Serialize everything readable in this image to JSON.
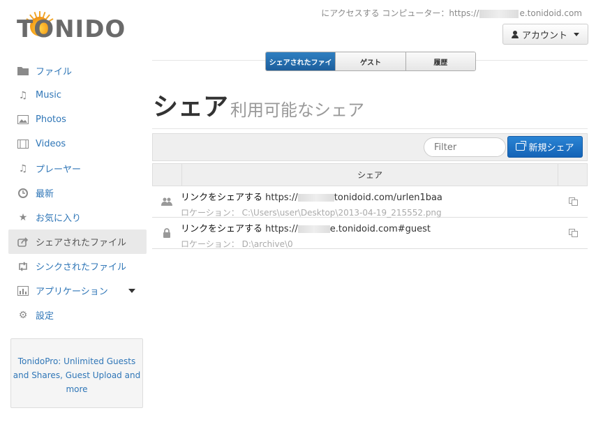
{
  "header": {
    "logo_text": "TONIDO",
    "access_prefix": "にアクセスする コンピューター：https://",
    "access_suffix": "e.tonidoid.com",
    "account_label": "アカウント"
  },
  "sidebar": {
    "items": [
      {
        "label": "ファイル",
        "icon": "folder-icon"
      },
      {
        "label": "Music",
        "icon": "music-icon"
      },
      {
        "label": "Photos",
        "icon": "photo-icon"
      },
      {
        "label": "Videos",
        "icon": "film-icon"
      },
      {
        "label": "プレーヤー",
        "icon": "music-icon"
      },
      {
        "label": "最新",
        "icon": "clock-icon"
      },
      {
        "label": "お気に入り",
        "icon": "star-icon"
      },
      {
        "label": "シェアされたファイル",
        "icon": "share-icon",
        "active": true
      },
      {
        "label": "シンクされたファイル",
        "icon": "sync-icon"
      },
      {
        "label": "アプリケーション",
        "icon": "chart-icon"
      },
      {
        "label": "設定",
        "icon": "gears-icon"
      }
    ],
    "promo": "TonidoPro: Unlimited Guests and Shares, Guest Upload and more"
  },
  "tabs": [
    {
      "label": "シェアされたファイ",
      "active": true
    },
    {
      "label": "ゲスト"
    },
    {
      "label": "履歴"
    }
  ],
  "page": {
    "title": "シェア",
    "subtitle": "利用可能なシェア"
  },
  "toolbar": {
    "filter_placeholder": "Filter",
    "new_share_label": "新規シェア"
  },
  "table": {
    "header": "シェア",
    "rows": [
      {
        "icon": "group-icon",
        "label": "リンクをシェアする",
        "url_prefix": "https://",
        "url_suffix": "tonidoid.com/urlen1baa",
        "location_label": "ロケーション：",
        "location": "C:\\Users\\user\\Desktop\\2013-04-19_215552.png"
      },
      {
        "icon": "lock-icon",
        "label": "リンクをシェアする",
        "url_prefix": "https://",
        "url_suffix": "e.tonidoid.com#guest",
        "location_label": "ロケーション：",
        "location": "D:\\archive\\0"
      }
    ]
  },
  "colors": {
    "link": "#2f76b7",
    "primary_button": "#1a6fc4",
    "active_tab": "#1f6aaa"
  }
}
